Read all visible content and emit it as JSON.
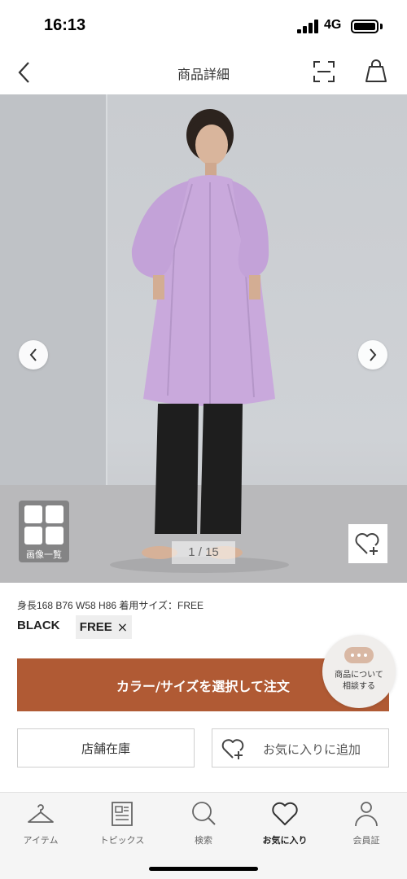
{
  "status_bar": {
    "time": "16:13",
    "network": "4G"
  },
  "nav": {
    "title": "商品詳細"
  },
  "image": {
    "gallery_label": "画像一覧",
    "page_indicator": "1 / 15"
  },
  "details": {
    "model_info": "身長168 B76 W58 H86 着用サイズ：FREE",
    "color": "BLACK",
    "size": "FREE",
    "size_clear": "×"
  },
  "actions": {
    "select_label": "カラー/サイズを選択して注文",
    "consult_line1": "商品について",
    "consult_line2": "相談する",
    "store_stock_label": "店舗在庫",
    "add_favorite_label": "お気に入りに追加"
  },
  "tabs": [
    {
      "label": "アイテム",
      "icon": "hanger-icon"
    },
    {
      "label": "トピックス",
      "icon": "newspaper-icon"
    },
    {
      "label": "検索",
      "icon": "search-icon"
    },
    {
      "label": "お気に入り",
      "icon": "heart-icon",
      "active": true
    },
    {
      "label": "会員証",
      "icon": "person-icon"
    }
  ],
  "colors": {
    "accent": "#b05a34",
    "garment": "#c9a9dc",
    "pants": "#1e1e1e"
  }
}
